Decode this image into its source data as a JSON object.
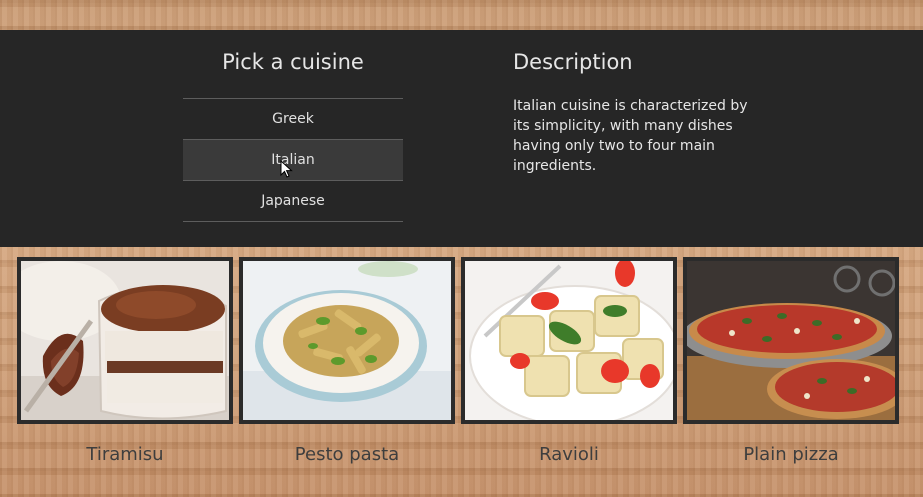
{
  "picker": {
    "title": "Pick a cuisine",
    "items": [
      {
        "label": "Greek"
      },
      {
        "label": "Italian"
      },
      {
        "label": "Japanese"
      }
    ],
    "selected": "Italian"
  },
  "description": {
    "title": "Description",
    "text": "Italian cuisine is characterized by its simplicity, with many dishes having only two to four main ingredients."
  },
  "dishes": [
    {
      "name": "Tiramisu",
      "icon": "tiramisu-photo"
    },
    {
      "name": "Pesto pasta",
      "icon": "pesto-pasta-photo"
    },
    {
      "name": "Ravioli",
      "icon": "ravioli-photo"
    },
    {
      "name": "Plain pizza",
      "icon": "pizza-photo"
    }
  ],
  "colors": {
    "panel": "#262626",
    "panel_text": "#e6e6e6",
    "selected_item": "#3a3a3a",
    "divider": "#5d5d5d",
    "caption_text": "#3e3e3e",
    "card_border": "#2b2b2b"
  }
}
